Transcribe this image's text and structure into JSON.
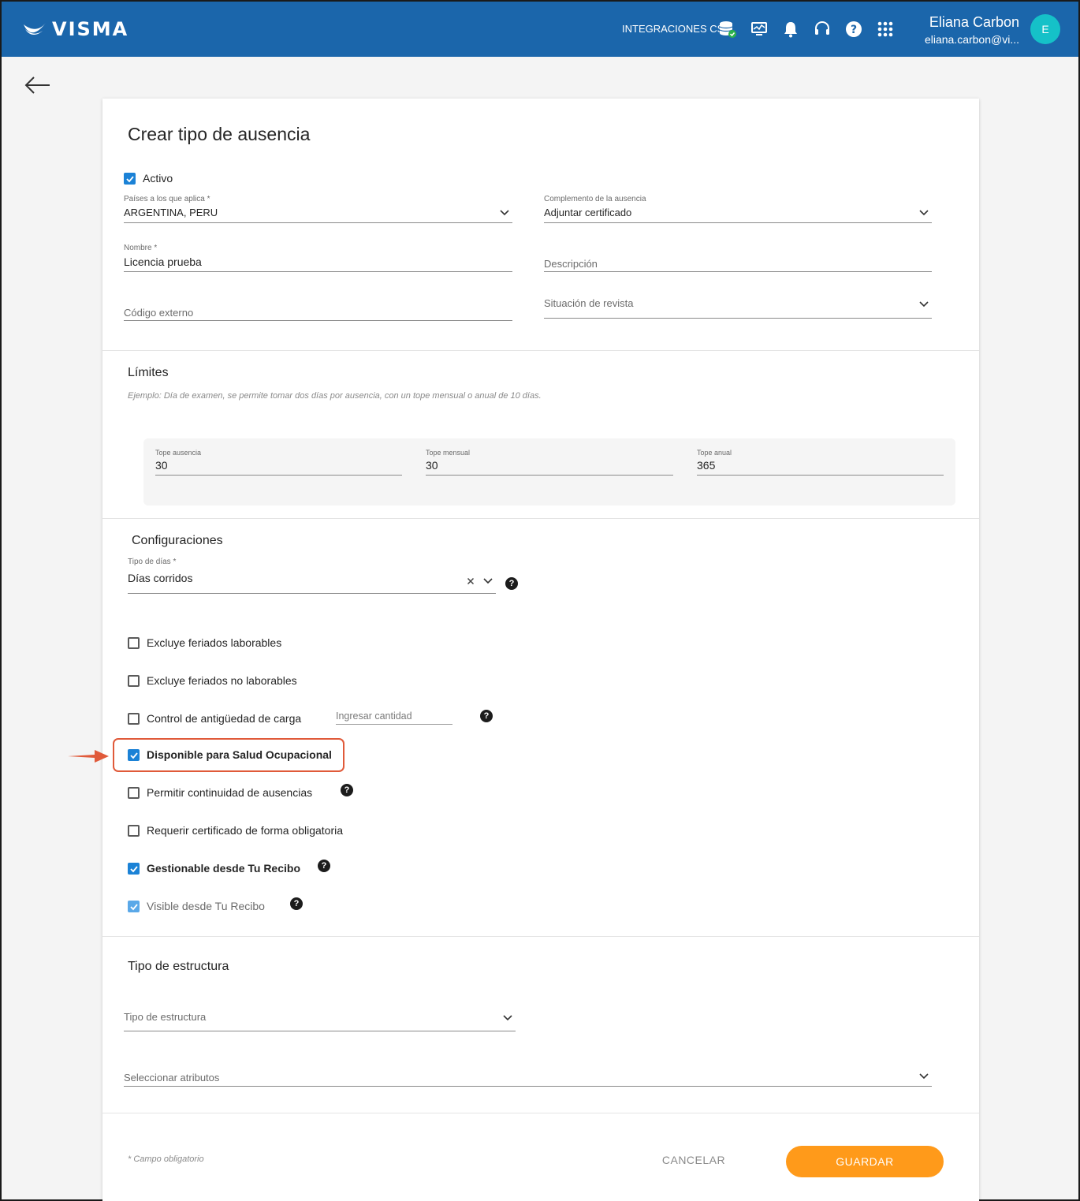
{
  "header": {
    "logo_text": "VISMA",
    "integrations_label": "INTEGRACIONES CS",
    "user_name": "Eliana Carbon",
    "user_email": "eliana.carbon@vi...",
    "avatar_letter": "E",
    "icons": [
      "database-status-icon",
      "monitor-icon",
      "bell-icon",
      "headset-icon",
      "help-icon",
      "apps-grid-icon"
    ],
    "colors": {
      "brand": "#1b66ab",
      "avatar": "#15c1c8"
    }
  },
  "page": {
    "title": "Crear tipo de ausencia",
    "back_icon": "arrow-left-icon"
  },
  "form": {
    "activo": {
      "label": "Activo",
      "checked": true
    },
    "paises": {
      "label": "Países a los que aplica *",
      "value": "ARGENTINA, PERU"
    },
    "complemento": {
      "label": "Complemento de la ausencia",
      "value": "Adjuntar certificado"
    },
    "nombre": {
      "label": "Nombre *",
      "value": "Licencia prueba"
    },
    "descripcion": {
      "placeholder": "Descripción"
    },
    "codigo_externo": {
      "placeholder": "Código externo"
    },
    "situacion_revista": {
      "placeholder": "Situación de revista"
    }
  },
  "limites": {
    "title": "Límites",
    "hint": "Ejemplo: Día de examen, se permite tomar dos días por ausencia, con un tope mensual o anual de 10 días.",
    "tope_ausencia": {
      "label": "Tope ausencia",
      "value": "30"
    },
    "tope_mensual": {
      "label": "Tope mensual",
      "value": "30"
    },
    "tope_anual": {
      "label": "Tope anual",
      "value": "365"
    }
  },
  "configuraciones": {
    "title": "Configuraciones",
    "tipo_dias": {
      "label": "Tipo de días *",
      "value": "Días corridos",
      "help": "?"
    },
    "options": [
      {
        "label": "Excluye feriados laborables",
        "checked": false
      },
      {
        "label": "Excluye feriados no laborables",
        "checked": false
      },
      {
        "label": "Control de antigüedad de carga",
        "checked": false,
        "input_placeholder": "Ingresar cantidad",
        "help": "?"
      },
      {
        "label": "Disponible para Salud Ocupacional",
        "checked": true,
        "highlighted": true
      },
      {
        "label": "Permitir continuidad de ausencias",
        "checked": false,
        "help": "?"
      },
      {
        "label": "Requerir certificado de forma obligatoria",
        "checked": false
      },
      {
        "label": "Gestionable desde Tu Recibo",
        "checked": true,
        "help": "?"
      },
      {
        "label": "Visible desde Tu Recibo",
        "checked": true,
        "help": "?"
      }
    ],
    "highlight_color": "#e05a3a"
  },
  "estructura": {
    "title": "Tipo de estructura",
    "tipo_placeholder": "Tipo de estructura",
    "atributos_placeholder": "Seleccionar atributos"
  },
  "footer": {
    "required_note": "* Campo obligatorio",
    "cancel_label": "CANCELAR",
    "save_label": "GUARDAR",
    "save_color": "#ff9a1a"
  }
}
